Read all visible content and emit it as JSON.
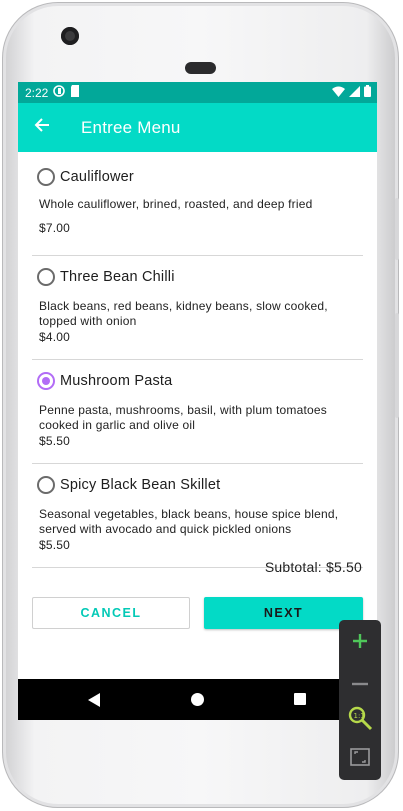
{
  "status_bar": {
    "time": "2:22",
    "icons": [
      "app-notification-icon",
      "sd-card-icon",
      "wifi-icon",
      "signal-icon",
      "battery-icon"
    ]
  },
  "app_bar": {
    "title": "Entree Menu",
    "back_icon": "arrow-left-icon"
  },
  "menu": {
    "items": [
      {
        "name": "Cauliflower",
        "description": "Whole cauliflower, brined, roasted, and deep fried",
        "price": "$7.00",
        "selected": false
      },
      {
        "name": "Three Bean Chilli",
        "description": "Black beans, red beans, kidney beans, slow cooked, topped with onion",
        "price": "$4.00",
        "selected": false
      },
      {
        "name": "Mushroom Pasta",
        "description": "Penne pasta, mushrooms, basil, with plum tomatoes cooked in garlic and olive oil",
        "price": "$5.50",
        "selected": true
      },
      {
        "name": "Spicy Black Bean Skillet",
        "description": "Seasonal vegetables, black beans, house spice blend, served with avocado and quick pickled onions",
        "price": "$5.50",
        "selected": false
      }
    ]
  },
  "subtotal": "Subtotal: $5.50",
  "buttons": {
    "cancel": "CANCEL",
    "next": "NEXT"
  },
  "colors": {
    "primary": "#03dac6",
    "status_bar": "#02a899",
    "radio_selected": "#b26cf6"
  },
  "emulator_controls": [
    "zoom-in-icon",
    "zoom-out-icon",
    "magnifier-icon",
    "fit-screen-icon"
  ]
}
